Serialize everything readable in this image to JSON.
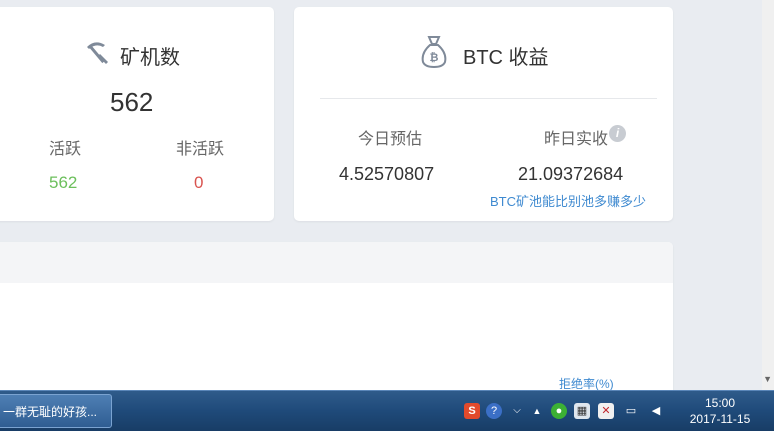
{
  "miner_card": {
    "title": "矿机数",
    "icon": "pickaxe-icon",
    "total": "562",
    "active_label": "活跃",
    "inactive_label": "非活跃",
    "active_value": "562",
    "inactive_value": "0"
  },
  "btc_card": {
    "title": "BTC 收益",
    "icon": "bitcoin-bag-icon",
    "today_label": "今日预估",
    "yesterday_label": "昨日实收",
    "today_value": "4.52570807",
    "yesterday_value": "21.09372684",
    "compare_link": "BTC矿池能比别池多赚多少",
    "info_icon": "info-icon"
  },
  "lower_panel": {
    "reject_rate_label": "拒绝率(%)"
  },
  "taskbar": {
    "task_label": "一群无耻的好孩...",
    "clock_time": "15:00",
    "clock_date": "2017-11-15"
  },
  "colors": {
    "background": "#e9ecf1",
    "active_green": "#6cbf5c",
    "inactive_red": "#d9534f",
    "link_blue": "#3f8ad0"
  }
}
